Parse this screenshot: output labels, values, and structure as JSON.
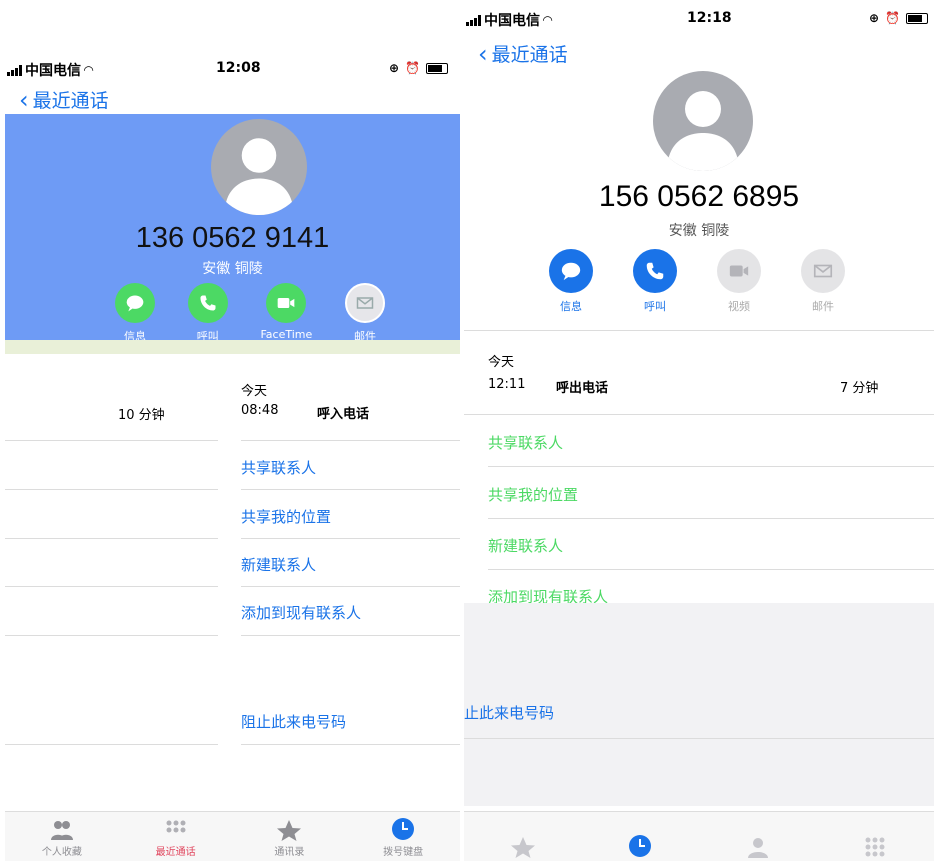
{
  "left": {
    "status": {
      "carrier": "中国电信",
      "time": "12:08"
    },
    "back_label": "最近通话",
    "number": "136 0562 9141",
    "location": "安徽 铜陵",
    "actions": [
      {
        "label": "信息",
        "icon": "message-icon"
      },
      {
        "label": "呼叫",
        "icon": "phone-icon"
      },
      {
        "label": "FaceTime",
        "icon": "video-icon"
      },
      {
        "label": "邮件",
        "icon": "mail-icon"
      }
    ],
    "history": {
      "day": "今天",
      "time": "08:48",
      "type": "呼入电话",
      "duration": "10 分钟"
    },
    "menu": [
      "共享联系人",
      "共享我的位置",
      "新建联系人",
      "添加到现有联系人"
    ],
    "block": "阻止此来电号码",
    "tabs": [
      "个人收藏",
      "最近通话",
      "通讯录",
      "拨号键盘"
    ]
  },
  "right": {
    "status": {
      "carrier": "中国电信",
      "time": "12:18"
    },
    "back_label": "最近通话",
    "number": "156 0562 6895",
    "location": "安徽 铜陵",
    "actions": [
      {
        "label": "信息",
        "icon": "message-icon",
        "enabled": true
      },
      {
        "label": "呼叫",
        "icon": "phone-icon",
        "enabled": true
      },
      {
        "label": "视频",
        "icon": "video-icon",
        "enabled": false
      },
      {
        "label": "邮件",
        "icon": "mail-icon",
        "enabled": false
      }
    ],
    "history": {
      "day": "今天",
      "time": "12:11",
      "type": "呼出电话",
      "duration": "7 分钟"
    },
    "menu": [
      "共享联系人",
      "共享我的位置",
      "新建联系人",
      "添加到现有联系人"
    ],
    "block": "止此来电号码"
  },
  "colors": {
    "ios_blue": "#1a73e8",
    "ios_green": "#4cd964",
    "left_header_bg": "#6e9bf5",
    "avatar_gray": "#a9abb1",
    "disabled_gray": "#e4e4e6",
    "tab_active": "#e0445c"
  }
}
